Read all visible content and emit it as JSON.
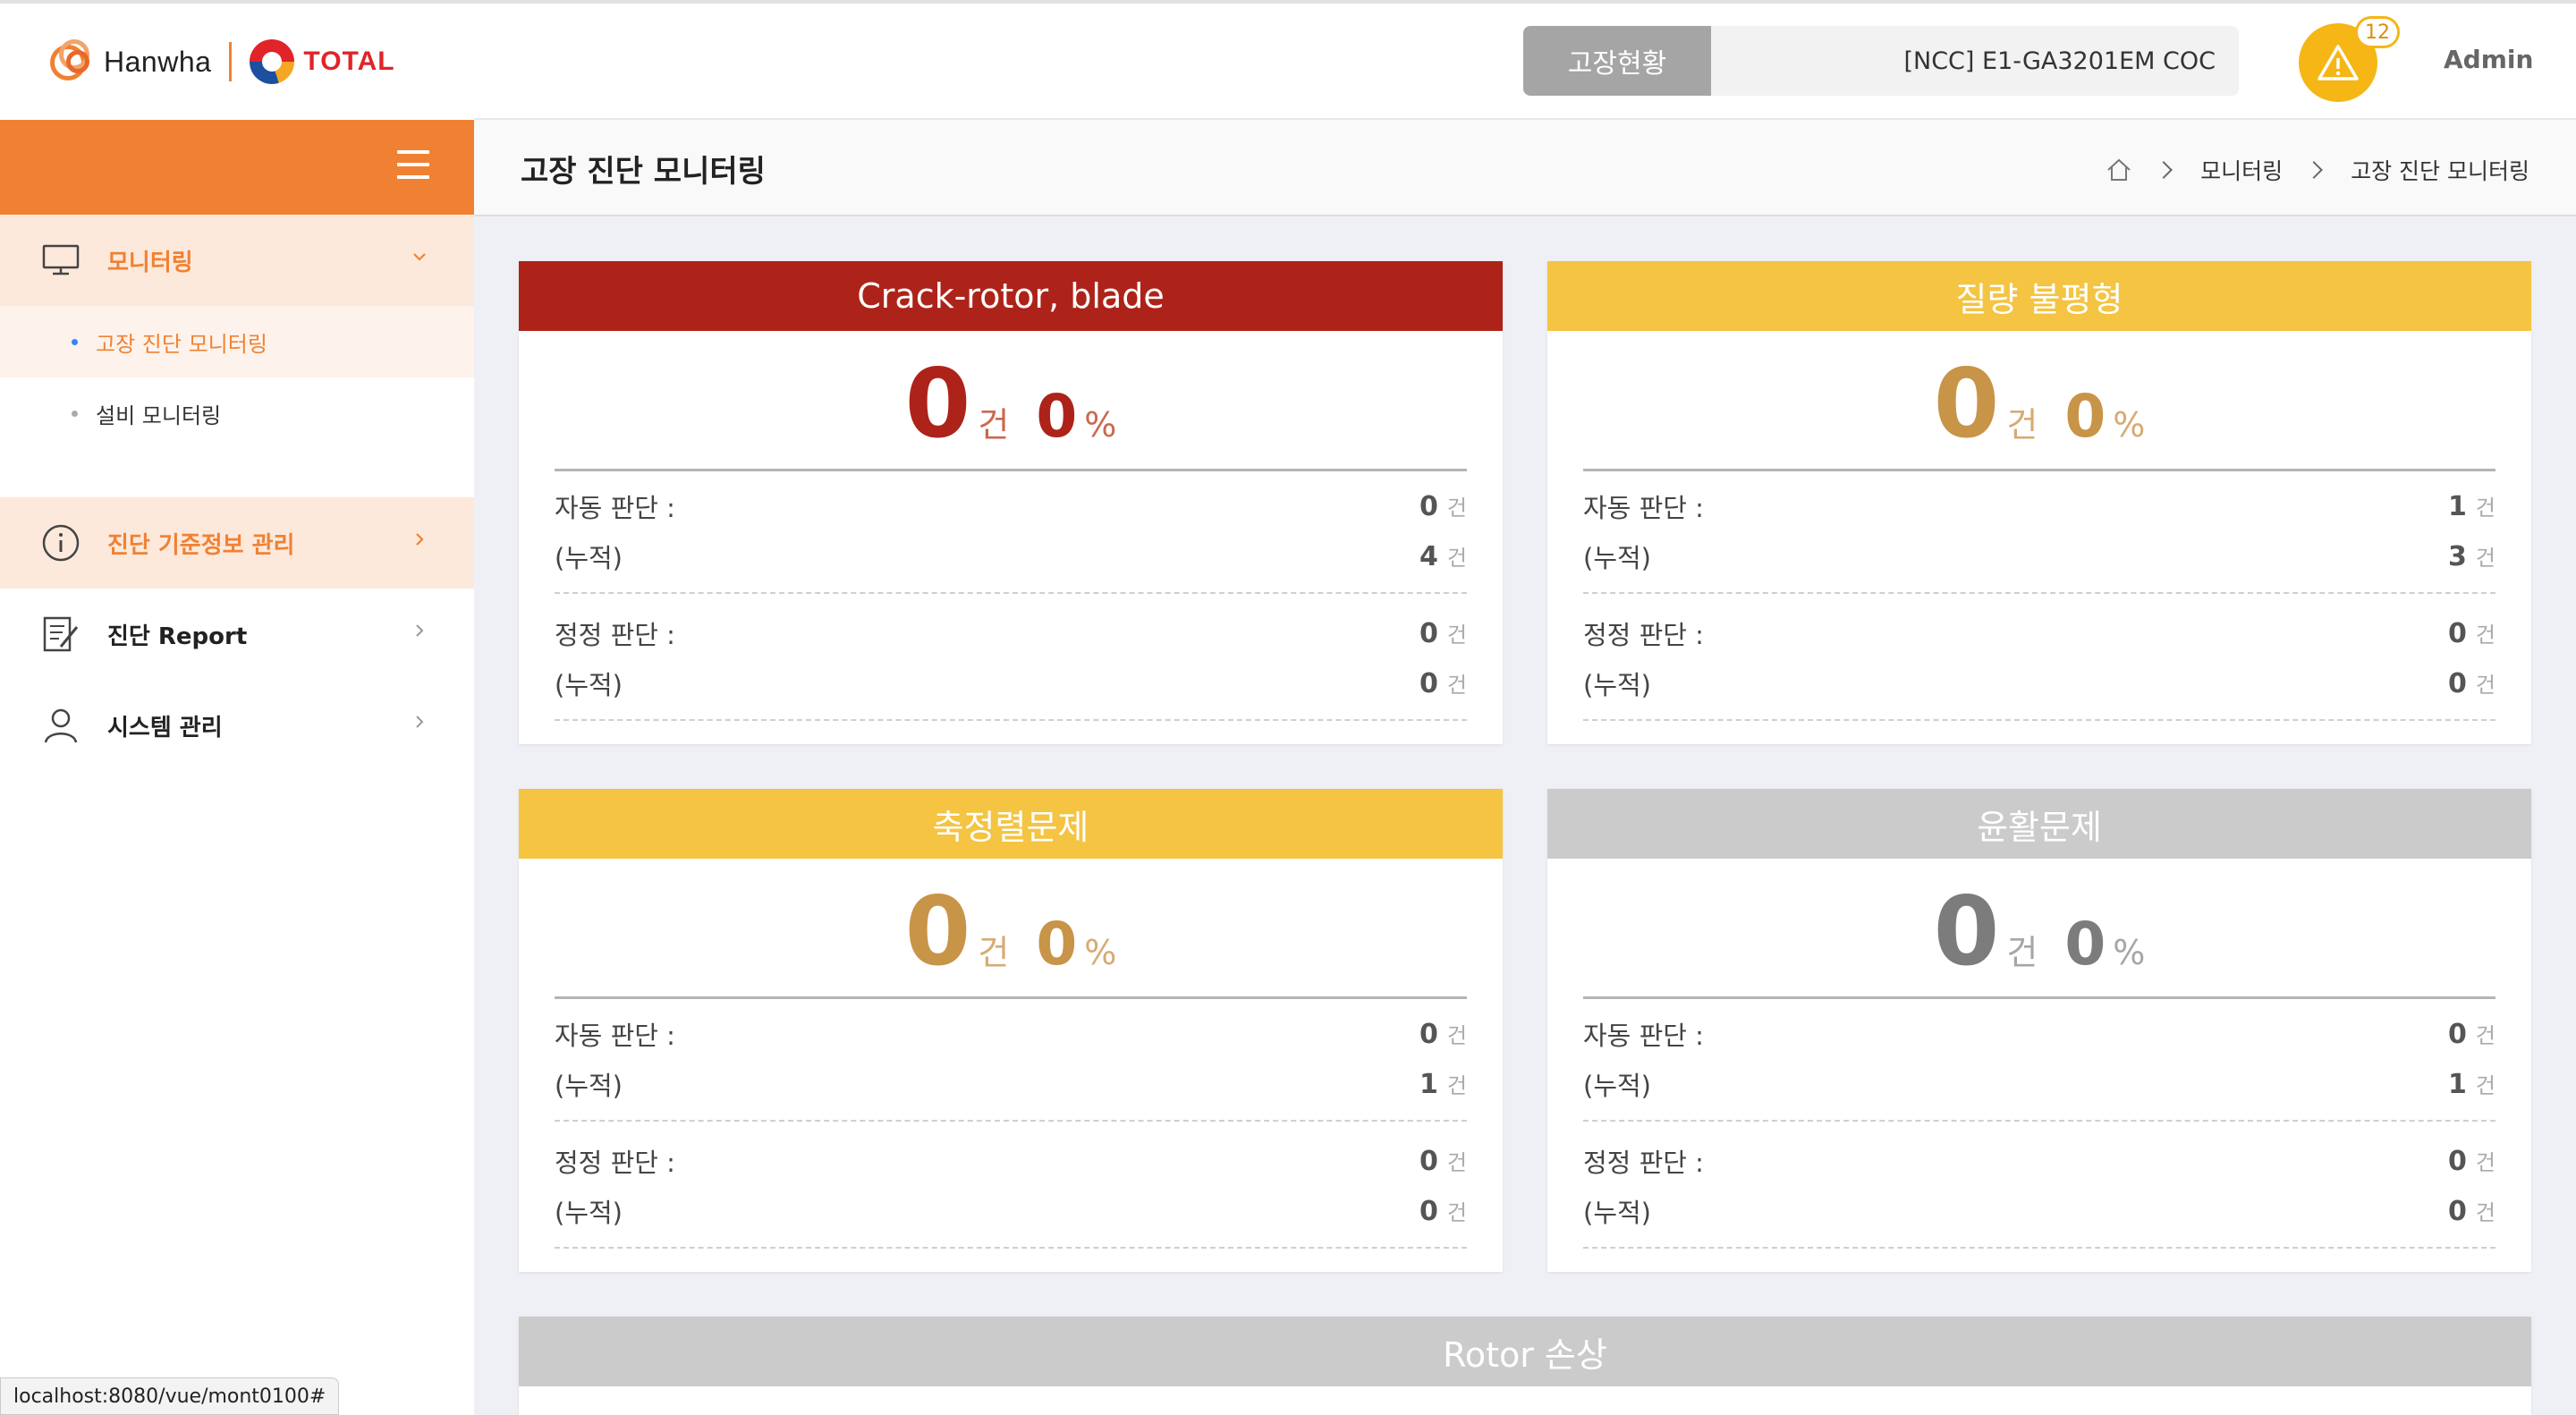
{
  "brand": {
    "left": "Hanwha",
    "right": "TOTAL"
  },
  "header": {
    "fault_status_label": "고장현황",
    "fault_device": "[NCC] E1-GA3201EM COC",
    "alarm_count": "12",
    "user": "Admin"
  },
  "sidebar": {
    "items": [
      {
        "label": "모니터링",
        "icon": "monitor-icon",
        "active": true,
        "children": [
          {
            "label": "고장 진단 모니터링",
            "active": true
          },
          {
            "label": "설비 모니터링",
            "active": false
          }
        ]
      },
      {
        "label": "진단 기준정보 관리",
        "icon": "info-circle-icon",
        "active": true
      },
      {
        "label": "진단 Report",
        "icon": "report-edit-icon",
        "active": false
      },
      {
        "label": "시스템 관리",
        "icon": "user-icon",
        "active": false
      }
    ]
  },
  "page": {
    "title": "고장 진단 모니터링",
    "breadcrumb": [
      "모니터링",
      "고장 진단 모니터링"
    ]
  },
  "labels": {
    "count_unit": "건",
    "percent_unit": "%",
    "auto_judgment": "자동 판단 :",
    "correct_judgment": "정정 판단 :",
    "cumulative": "(누적)"
  },
  "cards": [
    {
      "title": "Crack-rotor, blade",
      "color": "#ad2319",
      "count": "0",
      "percent": "0",
      "auto": "0",
      "auto_cum": "4",
      "correct": "0",
      "correct_cum": "0"
    },
    {
      "title": "질량 불평형",
      "color": "#f4c442",
      "count": "0",
      "percent": "0",
      "auto": "1",
      "auto_cum": "3",
      "correct": "0",
      "correct_cum": "0"
    },
    {
      "title": "축정렬문제",
      "color": "#f4c442",
      "count": "0",
      "percent": "0",
      "auto": "0",
      "auto_cum": "1",
      "correct": "0",
      "correct_cum": "0"
    },
    {
      "title": "윤활문제",
      "color": "#cbcbcb",
      "count": "0",
      "percent": "0",
      "auto": "0",
      "auto_cum": "1",
      "correct": "0",
      "correct_cum": "0"
    },
    {
      "title": "Rotor 손상",
      "color": "#cbcbcb"
    }
  ],
  "status_url": "localhost:8080/vue/mont0100#"
}
